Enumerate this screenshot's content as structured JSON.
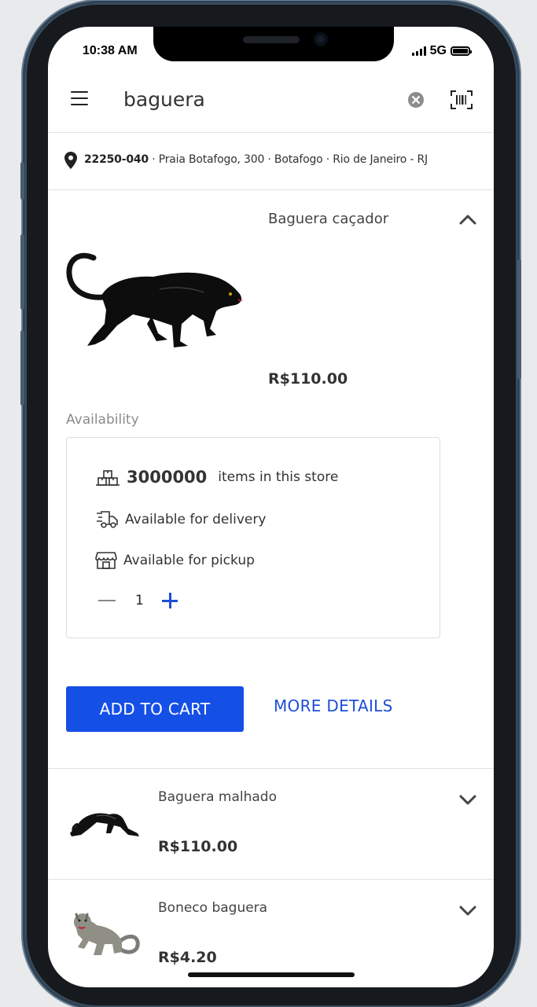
{
  "status": {
    "time": "10:38 AM",
    "network": "5G"
  },
  "search": {
    "query": "baguera",
    "placeholder": ""
  },
  "address": {
    "cep": "22250-040",
    "rest": "· Praia Botafogo, 300 · Botafogo · Rio de Janeiro - RJ"
  },
  "product": {
    "title": "Baguera caçador",
    "price": "R$110.00",
    "availability_label": "Availability",
    "stock_count": "3000000",
    "stock_suffix": "items in this store",
    "delivery": "Available for delivery",
    "pickup": "Available for pickup",
    "quantity": "1"
  },
  "actions": {
    "add_to_cart": "ADD TO CART",
    "more_details": "MORE DETAILS"
  },
  "list": [
    {
      "title": "Baguera malhado",
      "price": "R$110.00"
    },
    {
      "title": "Boneco baguera",
      "price": "R$4.20"
    }
  ],
  "colors": {
    "primary": "#1550e6",
    "link": "#1d4ed8",
    "frame": "#16191d"
  }
}
